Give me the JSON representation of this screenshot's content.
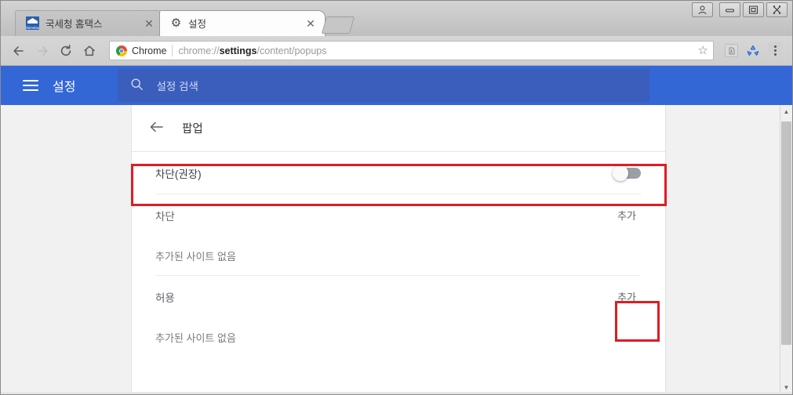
{
  "window": {
    "controls": [
      {
        "name": "user-profile",
        "glyph": "@"
      },
      {
        "name": "minimize",
        "glyph": "–"
      },
      {
        "name": "restore",
        "glyph": "▣"
      },
      {
        "name": "close",
        "glyph": "✕"
      }
    ]
  },
  "tabs": [
    {
      "title": "국세청 홈택스",
      "favicon": "hometax-icon",
      "favicon_text": "Hometax",
      "active": false,
      "close_label": "✕"
    },
    {
      "title": "설정",
      "favicon": "gear-icon",
      "favicon_glyph": "⚙",
      "active": true,
      "close_label": "✕"
    }
  ],
  "newtab_label": "+",
  "toolbar": {
    "back_glyph": "←",
    "forward_glyph": "→",
    "reload_glyph": "⟳",
    "home_glyph": "⌂",
    "chrome_label": "Chrome",
    "url_prefix": "chrome://",
    "url_bold": "settings",
    "url_suffix": "/content/popups",
    "url_full": "chrome://settings/content/popups",
    "bookmark_glyph": "☆",
    "pdf_glyph": "ᴘ",
    "recycle_glyph": "♻",
    "menu_name": "three-dot-menu"
  },
  "settings_header": {
    "menu_name": "hamburger-menu",
    "title": "설정",
    "search_placeholder": "설정 검색",
    "search_icon_glyph": "⌕",
    "bg_color": "#3367d6",
    "search_bg_color": "#3b5dbb"
  },
  "page": {
    "back_glyph": "←",
    "title": "팝업",
    "toggle": {
      "label": "차단(권장)",
      "state": "off"
    },
    "sections": [
      {
        "title": "차단",
        "add_label": "추가",
        "empty_text": "추가된 사이트 없음",
        "highlighted": false
      },
      {
        "title": "허용",
        "add_label": "추가",
        "empty_text": "추가된 사이트 없음",
        "highlighted": true
      }
    ]
  },
  "annotations": {
    "highlight_color": "#e11b22",
    "boxes": [
      {
        "name": "block-toggle-row"
      },
      {
        "name": "allow-add-button"
      }
    ]
  },
  "scrollbar": {
    "up_glyph": "▲",
    "down_glyph": "▼"
  }
}
